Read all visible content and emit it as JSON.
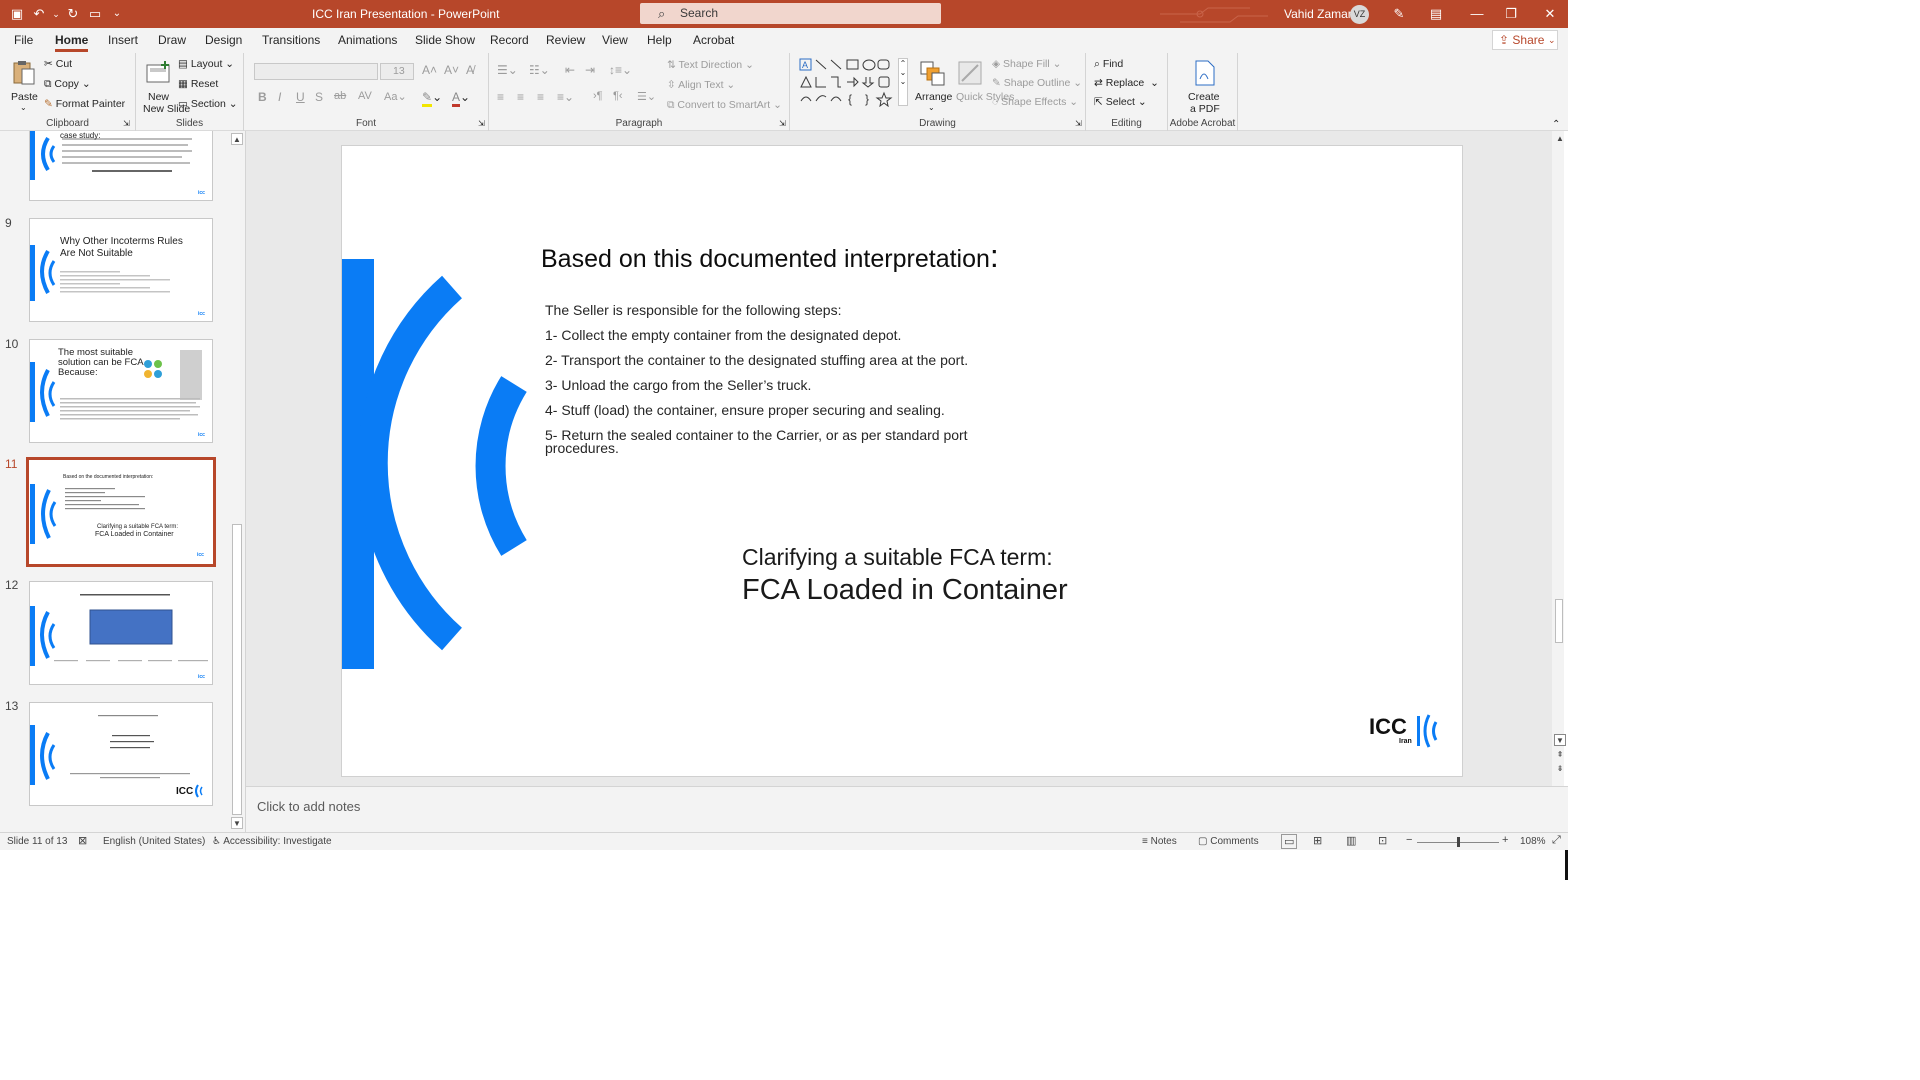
{
  "app": {
    "title": "ICC Iran Presentation  -  PowerPoint",
    "search_placeholder": "Search",
    "user_name": "Vahid Zamani",
    "user_initials": "VZ",
    "accent": "#b7472a"
  },
  "tabs": [
    "File",
    "Home",
    "Insert",
    "Draw",
    "Design",
    "Transitions",
    "Animations",
    "Slide Show",
    "Record",
    "Review",
    "View",
    "Help",
    "Acrobat"
  ],
  "active_tab": "Home",
  "share_label": "Share",
  "ribbon": {
    "clipboard": {
      "label": "Clipboard",
      "paste": "Paste",
      "cut": "Cut",
      "copy": "Copy",
      "format_painter": "Format Painter"
    },
    "slides": {
      "label": "Slides",
      "new_slide": "New Slide",
      "layout": "Layout",
      "reset": "Reset",
      "section": "Section"
    },
    "font": {
      "label": "Font",
      "size": "13"
    },
    "paragraph": {
      "label": "Paragraph",
      "text_direction": "Text Direction",
      "align_text": "Align Text",
      "convert_smartart": "Convert to SmartArt"
    },
    "drawing": {
      "label": "Drawing",
      "arrange": "Arrange",
      "quick_styles": "Quick Styles",
      "shape_fill": "Shape Fill",
      "shape_outline": "Shape Outline",
      "shape_effects": "Shape Effects"
    },
    "editing": {
      "label": "Editing",
      "find": "Find",
      "replace": "Replace",
      "select": "Select"
    },
    "acrobat": {
      "label": "Adobe Acrobat",
      "create_pdf": "Create a PDF"
    }
  },
  "thumbnails": [
    {
      "num": "",
      "title": "case study:",
      "partial": true
    },
    {
      "num": "9",
      "title": "Why Other Incoterms Rules Are Not Suitable"
    },
    {
      "num": "10",
      "title": "The most suitable solution can be FCA Because:"
    },
    {
      "num": "11",
      "title": "Based on the documented interpretation:",
      "selected": true,
      "sub1": "Clarifying a suitable FCA term:",
      "sub2": "FCA Loaded in Container"
    },
    {
      "num": "12",
      "title": "ICC Wisdom About Incoterms"
    },
    {
      "num": "13",
      "title": "Email: [.........]  Whatsapp: [.........]  Website: [.........]"
    }
  ],
  "slide": {
    "title": "Based on this documented interpretation",
    "title_colon": ":",
    "intro": "The Seller is responsible for the following steps:",
    "steps": [
      "1- Collect the empty container from the designated depot.",
      "2- Transport the container to the designated stuffing area at the port.",
      "3- Unload the cargo from the Seller’s truck.",
      "4- Stuff (load) the container, ensure proper securing and sealing.",
      "5- Return the sealed container to the Carrier, or as per standard port",
      "procedures."
    ],
    "subtitle1": "Clarifying a suitable FCA term:",
    "subtitle2": "FCA Loaded in Container",
    "logo_text": "ICC",
    "logo_sub": "Iran",
    "brand_blue": "#0a7cf5"
  },
  "notes_placeholder": "Click to add notes",
  "status": {
    "slide_count": "Slide 11 of 13",
    "language": "English (United States)",
    "accessibility": "Accessibility: Investigate",
    "notes": "Notes",
    "comments": "Comments",
    "zoom": "108%"
  }
}
